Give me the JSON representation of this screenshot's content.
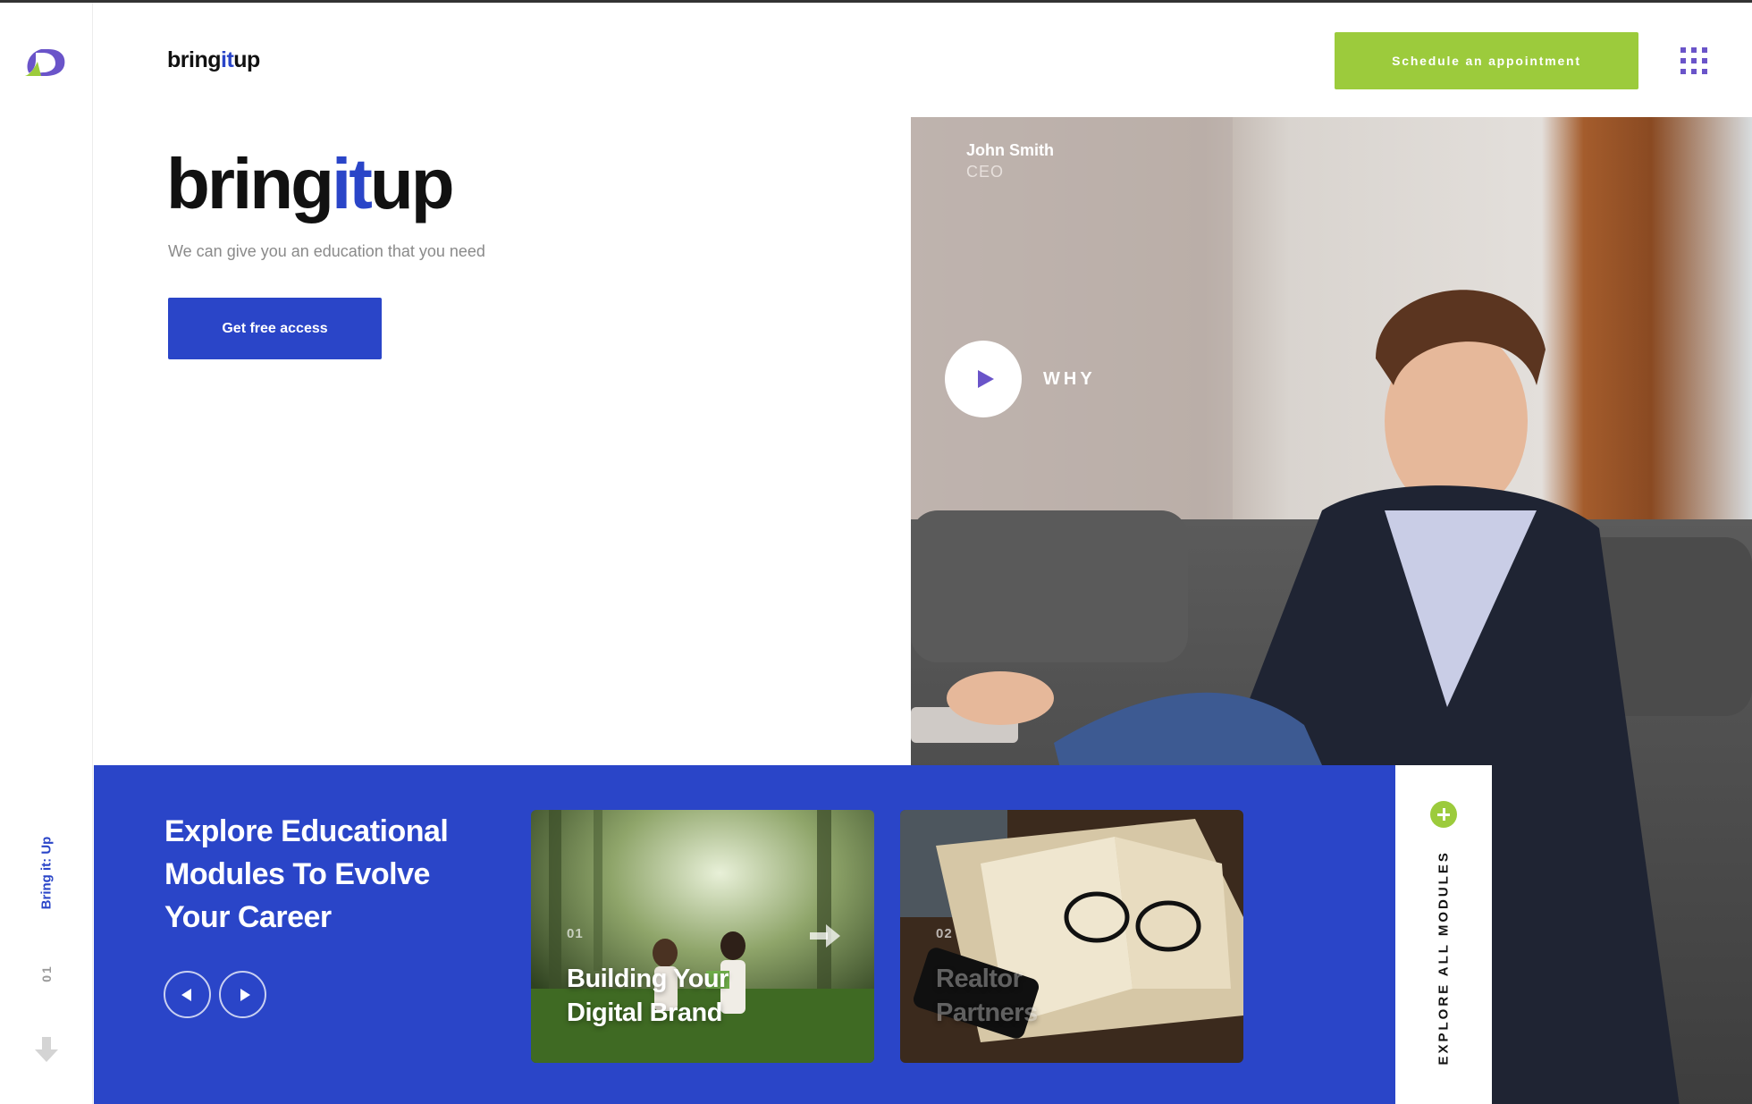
{
  "sidebar": {
    "logo": "bring-it-up-logo-icon",
    "vertical_title": "Bring it: Up",
    "slide_number": "01",
    "scroll_icon": "arrow-down-icon"
  },
  "header": {
    "brand_prefix": "bring",
    "brand_accent": "it",
    "brand_suffix": "up",
    "cta_label": "Schedule an appointment",
    "menu_icon": "grid-menu-icon"
  },
  "hero": {
    "brand_prefix": "bring",
    "brand_accent": "it",
    "brand_suffix": "up",
    "tagline": "We can give you an education that you need",
    "cta_label": "Get free access"
  },
  "video": {
    "person_name": "John Smith",
    "person_role": "CEO",
    "play_icon": "play-icon",
    "label": "WHY"
  },
  "modules": {
    "heading_line1": "Explore Educational",
    "heading_line2": "Modules To Evolve",
    "heading_line3": "Your Career",
    "prev_icon": "arrow-left-icon",
    "next_icon": "arrow-right-icon",
    "cards": [
      {
        "number": "01",
        "title_line1": "Building Your",
        "title_line2": "Digital Brand",
        "arrow_icon": "arrow-right-icon"
      },
      {
        "number": "02",
        "title_line1": "Realtor",
        "title_line2": "Partners"
      }
    ],
    "explore_label": "EXPLORE ALL MODULES",
    "explore_icon": "plus-icon"
  },
  "colors": {
    "brand_blue": "#2a45c8",
    "accent_green": "#9ccb3c",
    "menu_purple": "#6a54c9",
    "text_dark": "#111111",
    "text_muted": "#8a8a8a"
  }
}
